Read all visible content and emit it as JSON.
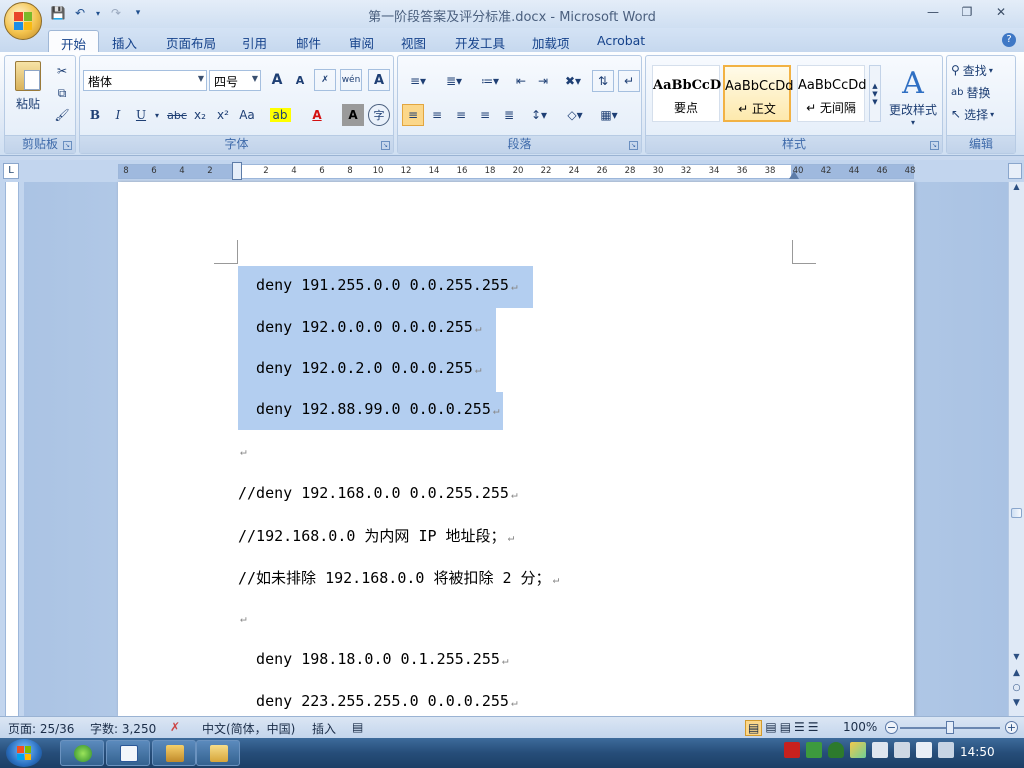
{
  "window": {
    "title": "第一阶段答案及评分标准.docx - Microsoft Word"
  },
  "tabs": [
    "开始",
    "插入",
    "页面布局",
    "引用",
    "邮件",
    "审阅",
    "视图",
    "开发工具",
    "加载项",
    "Acrobat"
  ],
  "ribbon": {
    "clipboard": {
      "label": "剪贴板",
      "paste": "粘贴"
    },
    "font": {
      "label": "字体",
      "font_name": "楷体",
      "font_size": "四号",
      "bold": "B",
      "italic": "I",
      "underline": "U",
      "strike": "abc",
      "subscript": "x₂",
      "superscript": "x²",
      "change_case": "Aa",
      "grow": "A",
      "shrink": "A",
      "font_color": "A",
      "char_shading": "A",
      "enclose": "字",
      "phonetic": "wén"
    },
    "paragraph": {
      "label": "段落"
    },
    "styles": {
      "label": "样式",
      "items": [
        {
          "sample": "AaBbCcD",
          "name": "要点"
        },
        {
          "sample": "AaBbCcDd",
          "name": "↵ 正文"
        },
        {
          "sample": "AaBbCcDd",
          "name": "↵ 无间隔"
        }
      ],
      "change_styles": "更改样式"
    },
    "editing": {
      "label": "编辑",
      "find": "查找",
      "replace": "替换",
      "select": "选择"
    }
  },
  "ruler": {
    "numbers": [
      "8",
      "6",
      "4",
      "2",
      "",
      "2",
      "4",
      "6",
      "8",
      "10",
      "12",
      "14",
      "16",
      "18",
      "20",
      "22",
      "24",
      "26",
      "28",
      "30",
      "32",
      "34",
      "36",
      "38",
      "40",
      "42",
      "44",
      "46",
      "48"
    ]
  },
  "document": {
    "lines": [
      {
        "text": "  deny 191.255.0.0 0.0.255.255",
        "selected": true
      },
      {
        "text": "  deny 192.0.0.0 0.0.0.255",
        "selected": true
      },
      {
        "text": "  deny 192.0.2.0 0.0.0.255",
        "selected": true
      },
      {
        "text": "  deny 192.88.99.0 0.0.0.255",
        "selected": true
      },
      {
        "text": "",
        "selected": false
      },
      {
        "text": "//deny 192.168.0.0 0.0.255.255",
        "selected": false
      },
      {
        "text": "//192.168.0.0 为内网 IP 地址段；",
        "selected": false
      },
      {
        "text": "//如未排除 192.168.0.0 将被扣除 2 分；",
        "selected": false
      },
      {
        "text": "",
        "selected": false
      },
      {
        "text": "  deny 198.18.0.0 0.1.255.255",
        "selected": false
      },
      {
        "text": "  deny 223.255.255.0 0.0.0.255",
        "selected": false
      }
    ],
    "paragraph_mark": "↵"
  },
  "status": {
    "page": "页面: 25/36",
    "words": "字数: 3,250",
    "language": "中文(简体，中国)",
    "mode": "插入",
    "zoom": "100%"
  },
  "taskbar": {
    "clock": "14:50"
  }
}
